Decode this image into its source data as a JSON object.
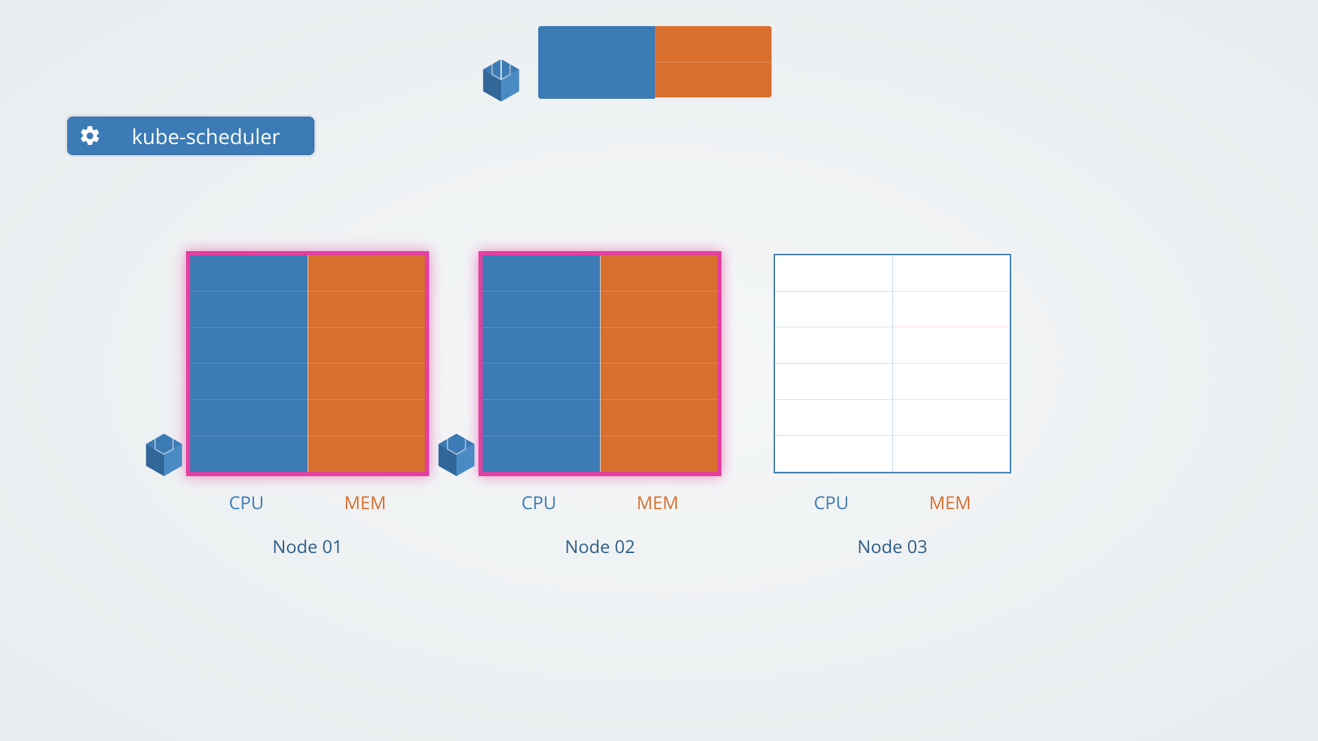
{
  "scheduler": {
    "label": "kube-scheduler"
  },
  "pending_pod": {
    "cpu_blocks": 1,
    "mem_blocks": 2
  },
  "resource_labels": {
    "cpu": "CPU",
    "mem": "MEM"
  },
  "nodes": [
    {
      "name": "Node 01",
      "highlighted": true,
      "has_pod_icon": true,
      "cpu_capacity": 6,
      "cpu_used": 6,
      "mem_capacity": 6,
      "mem_used": 6
    },
    {
      "name": "Node 02",
      "highlighted": true,
      "has_pod_icon": true,
      "cpu_capacity": 6,
      "cpu_used": 6,
      "mem_capacity": 6,
      "mem_used": 6
    },
    {
      "name": "Node 03",
      "highlighted": false,
      "has_pod_icon": false,
      "cpu_capacity": 6,
      "cpu_used": 0,
      "mem_capacity": 6,
      "mem_used": 0
    }
  ],
  "colors": {
    "cpu": "#3c7bb5",
    "mem": "#d96f2e",
    "highlight": "#e43fa0"
  }
}
